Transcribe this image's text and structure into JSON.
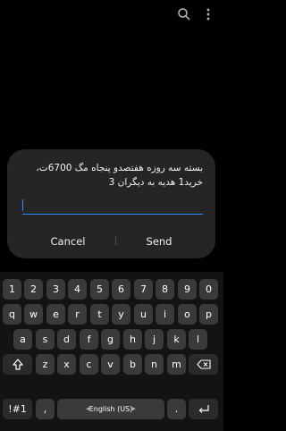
{
  "top_bar": {
    "icons": [
      "search-icon",
      "more-vertical-icon"
    ]
  },
  "dialog": {
    "message": "بسته سه روزه هفتصدو پنجاه مگ 6700ت، خرید1 هدیه به دیگران 3",
    "input_value": "",
    "cancel_label": "Cancel",
    "send_label": "Send",
    "accent_color": "#2d8cff"
  },
  "keyboard": {
    "row_numbers": [
      "1",
      "2",
      "3",
      "4",
      "5",
      "6",
      "7",
      "8",
      "9",
      "0"
    ],
    "row_top": [
      "q",
      "w",
      "e",
      "r",
      "t",
      "y",
      "u",
      "i",
      "o",
      "p"
    ],
    "row_home": [
      "a",
      "s",
      "d",
      "f",
      "g",
      "h",
      "j",
      "k",
      "l"
    ],
    "row_bottom": [
      "z",
      "x",
      "c",
      "v",
      "b",
      "n",
      "m"
    ],
    "shift_icon": "shift-icon",
    "backspace_icon": "backspace-icon",
    "symbols_label": "!#1",
    "comma_label": ",",
    "space_label": "English (US)",
    "period_label": ".",
    "enter_icon": "enter-icon"
  }
}
